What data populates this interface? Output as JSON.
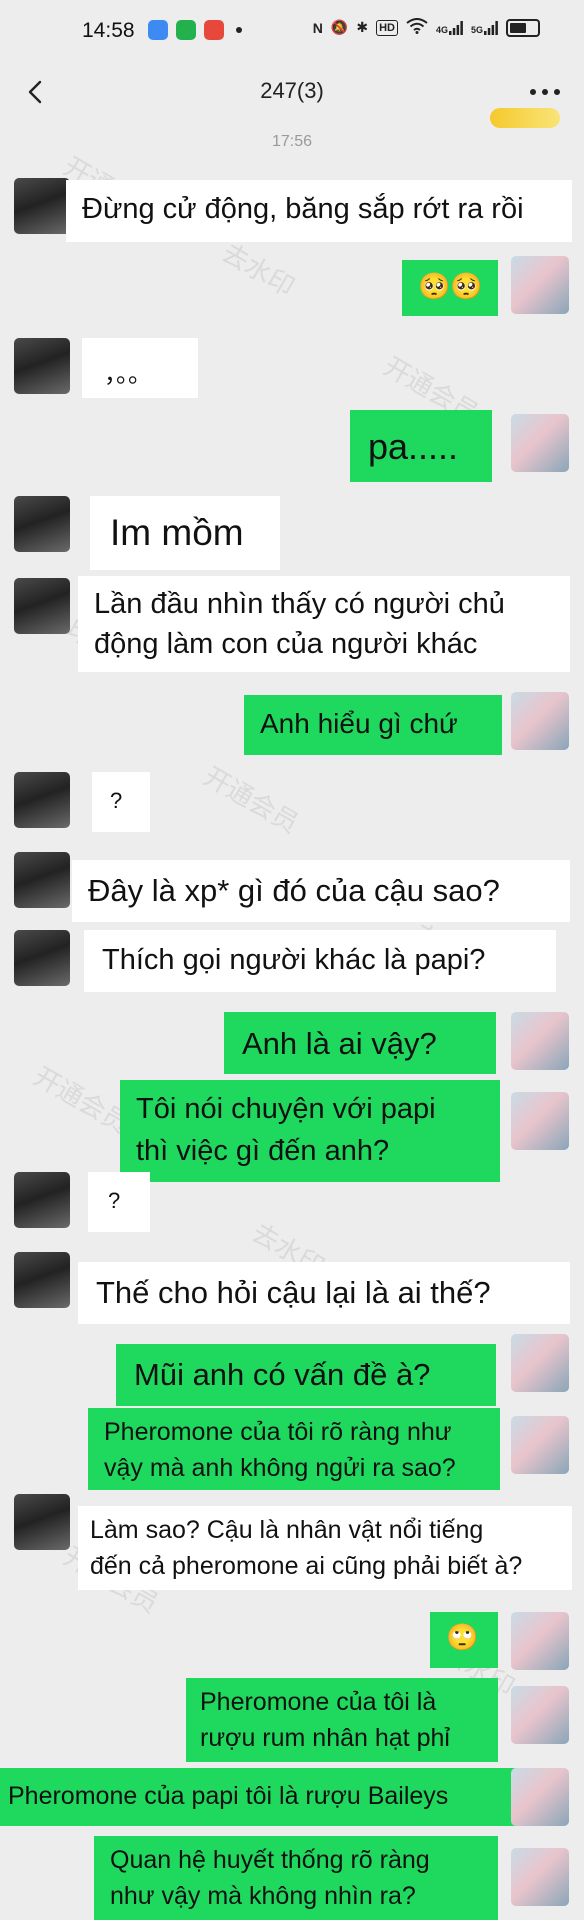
{
  "status": {
    "time": "14:58",
    "hd_label": "HD",
    "net1": "4G",
    "net2": "5G"
  },
  "header": {
    "title": "247(3)",
    "timestamp": "17:56"
  },
  "watermarks": [
    "开通会员",
    "去水印"
  ],
  "colors": {
    "background": "#ededed",
    "incoming_bubble": "#ffffff",
    "outgoing_bubble": "#1fd95f"
  },
  "messages": [
    {
      "side": "left",
      "lines": [
        "Đừng cử động, băng sắp rớt ra rồi"
      ]
    },
    {
      "side": "right",
      "lines": [
        "🥺🥺"
      ]
    },
    {
      "side": "left",
      "lines": [
        "，。。"
      ]
    },
    {
      "side": "right",
      "lines": [
        "pa....."
      ]
    },
    {
      "side": "left",
      "lines": [
        "Im mồm"
      ]
    },
    {
      "side": "left",
      "lines": [
        "Lần đầu nhìn thấy có người chủ",
        "động làm con của người khác"
      ]
    },
    {
      "side": "right",
      "lines": [
        "Anh hiểu gì chứ"
      ]
    },
    {
      "side": "left",
      "lines": [
        "?"
      ]
    },
    {
      "side": "left",
      "lines": [
        "Đây là xp* gì đó của cậu sao?"
      ]
    },
    {
      "side": "left",
      "lines": [
        "Thích gọi người khác là papi?"
      ]
    },
    {
      "side": "right",
      "lines": [
        "Anh là ai vậy?"
      ]
    },
    {
      "side": "right",
      "lines": [
        "Tôi nói chuyện với papi",
        "thì việc gì đến anh?"
      ]
    },
    {
      "side": "left",
      "lines": [
        "?"
      ]
    },
    {
      "side": "left",
      "lines": [
        "Thế cho hỏi cậu lại là ai thế?"
      ]
    },
    {
      "side": "right",
      "lines": [
        "Mũi anh có vấn đề à?"
      ]
    },
    {
      "side": "right",
      "lines": [
        "Pheromone của tôi rõ ràng như",
        "vậy mà anh không ngửi ra sao?"
      ]
    },
    {
      "side": "left",
      "lines": [
        "Làm sao? Cậu là nhân vật nổi tiếng",
        "đến cả pheromone ai cũng phải biết à?"
      ]
    },
    {
      "side": "right",
      "lines": [
        "🙄"
      ]
    },
    {
      "side": "right",
      "lines": [
        "Pheromone của tôi là",
        "rượu rum nhân hạt phỉ"
      ]
    },
    {
      "side": "right",
      "lines": [
        "Pheromone của papi tôi là rượu Baileys"
      ]
    },
    {
      "side": "right",
      "lines": [
        "Quan hệ huyết thống rõ ràng",
        "như vậy mà không nhìn ra?"
      ]
    }
  ]
}
